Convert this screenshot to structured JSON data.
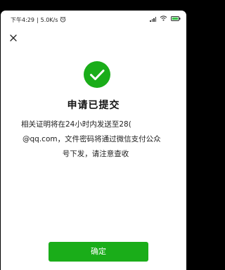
{
  "status_bar": {
    "time": "下午4:29",
    "speed": "5.0K/s",
    "battery_color": "#3dbf4a"
  },
  "icons": {
    "close": "close-icon",
    "success": "check-circle-icon",
    "alarm": "alarm-icon",
    "signal": "signal-icon",
    "wifi": "wifi-icon",
    "battery": "battery-icon"
  },
  "main": {
    "title": "申请已提交",
    "description_lines": [
      "相关证明将在24小时内发送至28(",
      "@qq.com，文件密码将通过微信支付公众",
      "号下发，请注意查收"
    ],
    "confirm_label": "确定"
  },
  "colors": {
    "accent": "#1aad19",
    "icon_green": "#1aad19"
  }
}
